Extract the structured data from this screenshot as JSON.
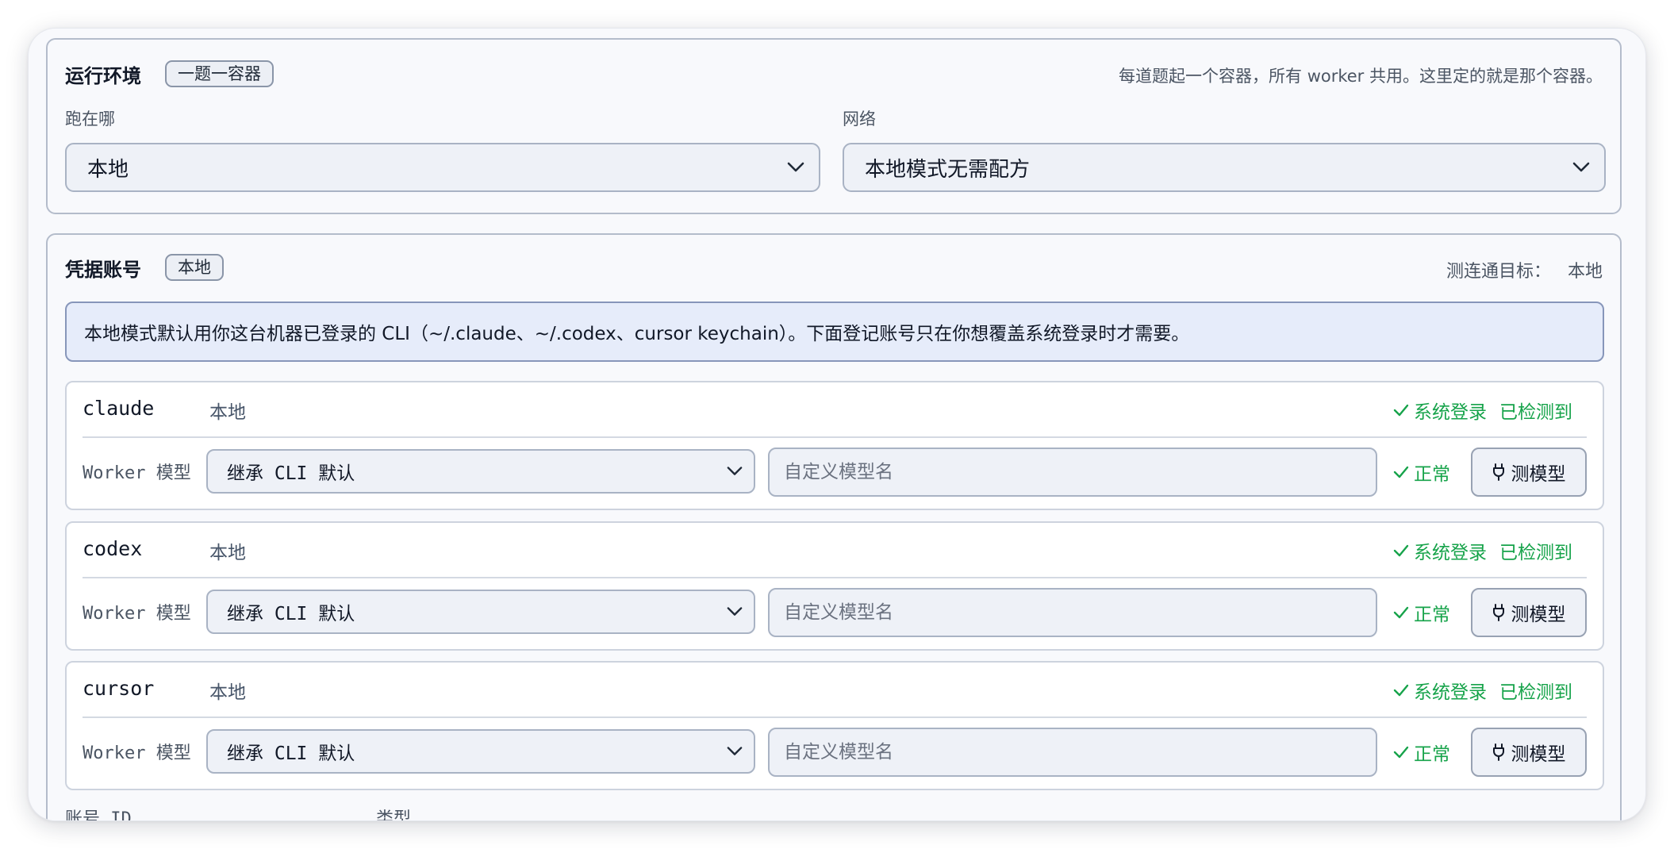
{
  "env": {
    "title": "运行环境",
    "badge": "一题一容器",
    "help": "每道题起一个容器，所有 worker 共用。这里定的就是那个容器。",
    "location_label": "跑在哪",
    "location_value": "本地",
    "network_label": "网络",
    "network_value": "本地模式无需配方"
  },
  "cred": {
    "title": "凭据账号",
    "badge": "本地",
    "target_label": "测连通目标：",
    "target_value": "本地",
    "info": "本地模式默认用你这台机器已登录的 CLI（~/.claude、~/.codex、cursor keychain）。下面登记账号只在你想覆盖系统登录时才需要。",
    "providers": [
      {
        "name": "claude",
        "scope": "本地",
        "login_status": "系统登录",
        "detect_status": "已检测到",
        "model_label": "Worker 模型",
        "model_value": "继承 CLI 默认",
        "custom_placeholder": "自定义模型名",
        "health": "正常",
        "test_label": "测模型"
      },
      {
        "name": "codex",
        "scope": "本地",
        "login_status": "系统登录",
        "detect_status": "已检测到",
        "model_label": "Worker 模型",
        "model_value": "继承 CLI 默认",
        "custom_placeholder": "自定义模型名",
        "health": "正常",
        "test_label": "测模型"
      },
      {
        "name": "cursor",
        "scope": "本地",
        "login_status": "系统登录",
        "detect_status": "已检测到",
        "model_label": "Worker 模型",
        "model_value": "继承 CLI 默认",
        "custom_placeholder": "自定义模型名",
        "health": "正常",
        "test_label": "测模型"
      }
    ],
    "account_id_label": "账号 ID",
    "type_label": "类型"
  },
  "colors": {
    "success": "#16a34a",
    "info_bg": "#e6ecfa"
  },
  "icons": {
    "check": "check-icon",
    "chevron": "chevron-down-icon",
    "plug": "plug-icon"
  }
}
